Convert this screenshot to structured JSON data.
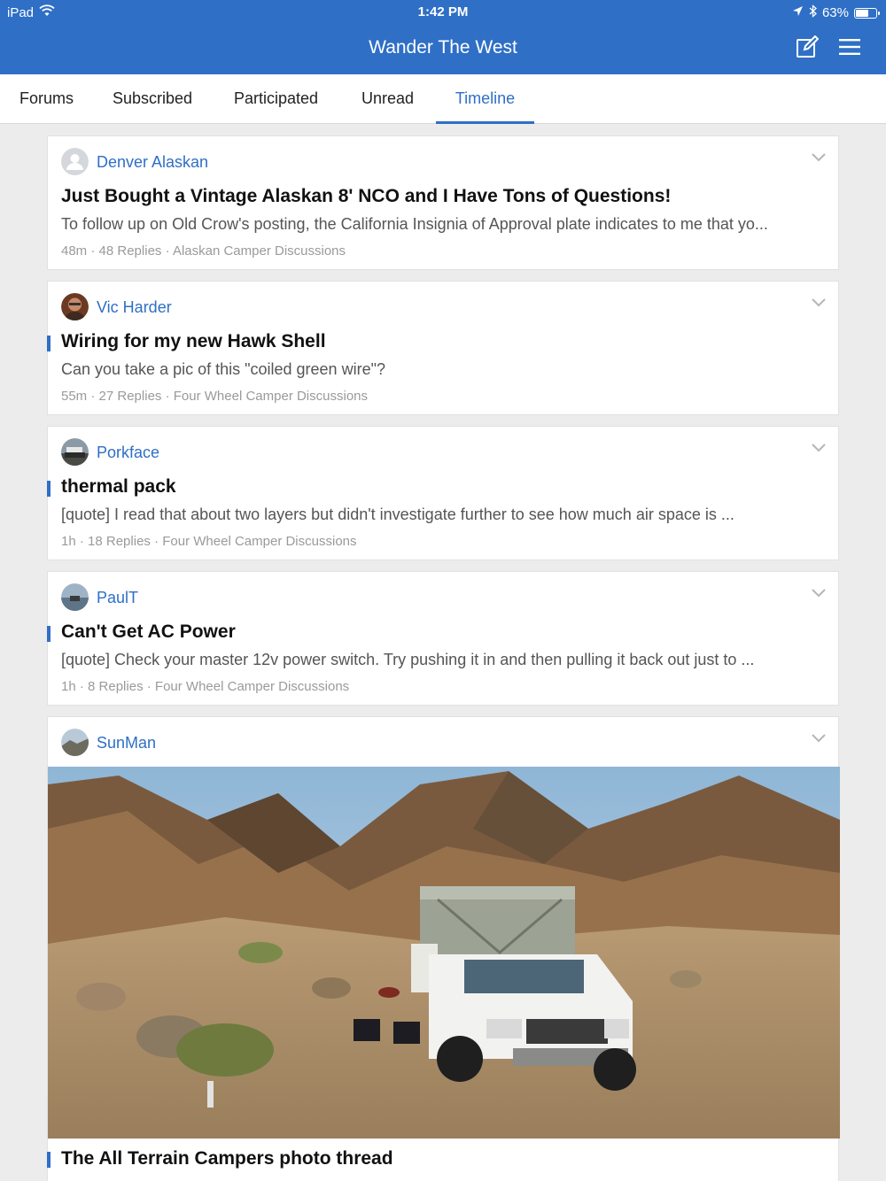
{
  "status_bar": {
    "device": "iPad",
    "time": "1:42 PM",
    "battery": "63%",
    "battery_level": 0.63
  },
  "header": {
    "title": "Wander The West",
    "compose_icon": "compose-icon",
    "menu_icon": "hamburger-menu-icon"
  },
  "tabs": [
    {
      "label": "Forums"
    },
    {
      "label": "Subscribed"
    },
    {
      "label": "Participated"
    },
    {
      "label": "Unread"
    },
    {
      "label": "Timeline",
      "active": true
    }
  ],
  "threads": [
    {
      "author": "Denver Alaskan",
      "title": "Just Bought a Vintage Alaskan 8' NCO and I Have Tons of Questions!",
      "snippet": "To follow up on Old Crow's posting, the California Insignia of Approval plate indicates to me that yo...",
      "time": "48m",
      "replies": "48 Replies",
      "forum": "Alaskan Camper Discussions",
      "unread_marker": false
    },
    {
      "author": "Vic Harder",
      "title": "Wiring for my new Hawk Shell",
      "snippet": "Can you take a pic of this \"coiled green wire\"?",
      "time": "55m",
      "replies": "27 Replies",
      "forum": "Four Wheel Camper Discussions",
      "unread_marker": true
    },
    {
      "author": "Porkface",
      "title": "thermal pack",
      "snippet": "[quote] I read that about two layers but didn't investigate further to see how much air space is ...",
      "time": "1h",
      "replies": "18 Replies",
      "forum": "Four Wheel Camper Discussions",
      "unread_marker": true
    },
    {
      "author": "PaulT",
      "title": "Can't Get AC Power",
      "snippet": "[quote] Check your master 12v power switch. Try pushing it in and then pulling it back out just to ...",
      "time": "1h",
      "replies": "8 Replies",
      "forum": "Four Wheel Camper Discussions",
      "unread_marker": true
    },
    {
      "author": "SunMan",
      "title": "The All Terrain Campers photo thread",
      "unread_marker": true
    }
  ],
  "colors": {
    "accent": "#2f6fc6",
    "background": "#ececec",
    "card": "#ffffff"
  }
}
